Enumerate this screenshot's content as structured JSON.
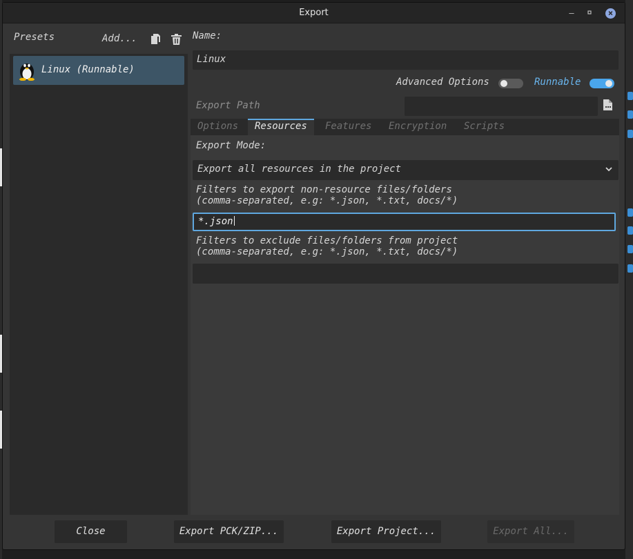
{
  "window": {
    "title": "Export"
  },
  "presets": {
    "label": "Presets",
    "add_label": "Add...",
    "items": [
      {
        "label": "Linux (Runnable)",
        "icon": "tux-icon",
        "selected": true
      }
    ]
  },
  "name": {
    "label": "Name:",
    "value": "Linux"
  },
  "advanced_options": {
    "label": "Advanced Options",
    "on": false
  },
  "runnable": {
    "label": "Runnable",
    "on": true
  },
  "export_path": {
    "label": "Export Path",
    "value": ""
  },
  "tabs": [
    {
      "label": "Options",
      "active": false
    },
    {
      "label": "Resources",
      "active": true
    },
    {
      "label": "Features",
      "active": false
    },
    {
      "label": "Encryption",
      "active": false
    },
    {
      "label": "Scripts",
      "active": false
    }
  ],
  "resources": {
    "export_mode_label": "Export Mode:",
    "export_mode_value": "Export all resources in the project",
    "include_filter_label_1": "Filters to export non-resource files/folders",
    "include_filter_label_2": "(comma-separated, e.g: *.json, *.txt, docs/*)",
    "include_filter_value": "*.json",
    "exclude_filter_label_1": "Filters to exclude files/folders from project",
    "exclude_filter_label_2": "(comma-separated, e.g: *.json, *.txt, docs/*)",
    "exclude_filter_value": ""
  },
  "footer": {
    "close": "Close",
    "export_pck": "Export PCK/ZIP...",
    "export_project": "Export Project...",
    "export_all": "Export All..."
  },
  "colors": {
    "accent": "#5fa8e0",
    "selected": "#3d5566",
    "runnable_text": "#6ab6ef"
  }
}
